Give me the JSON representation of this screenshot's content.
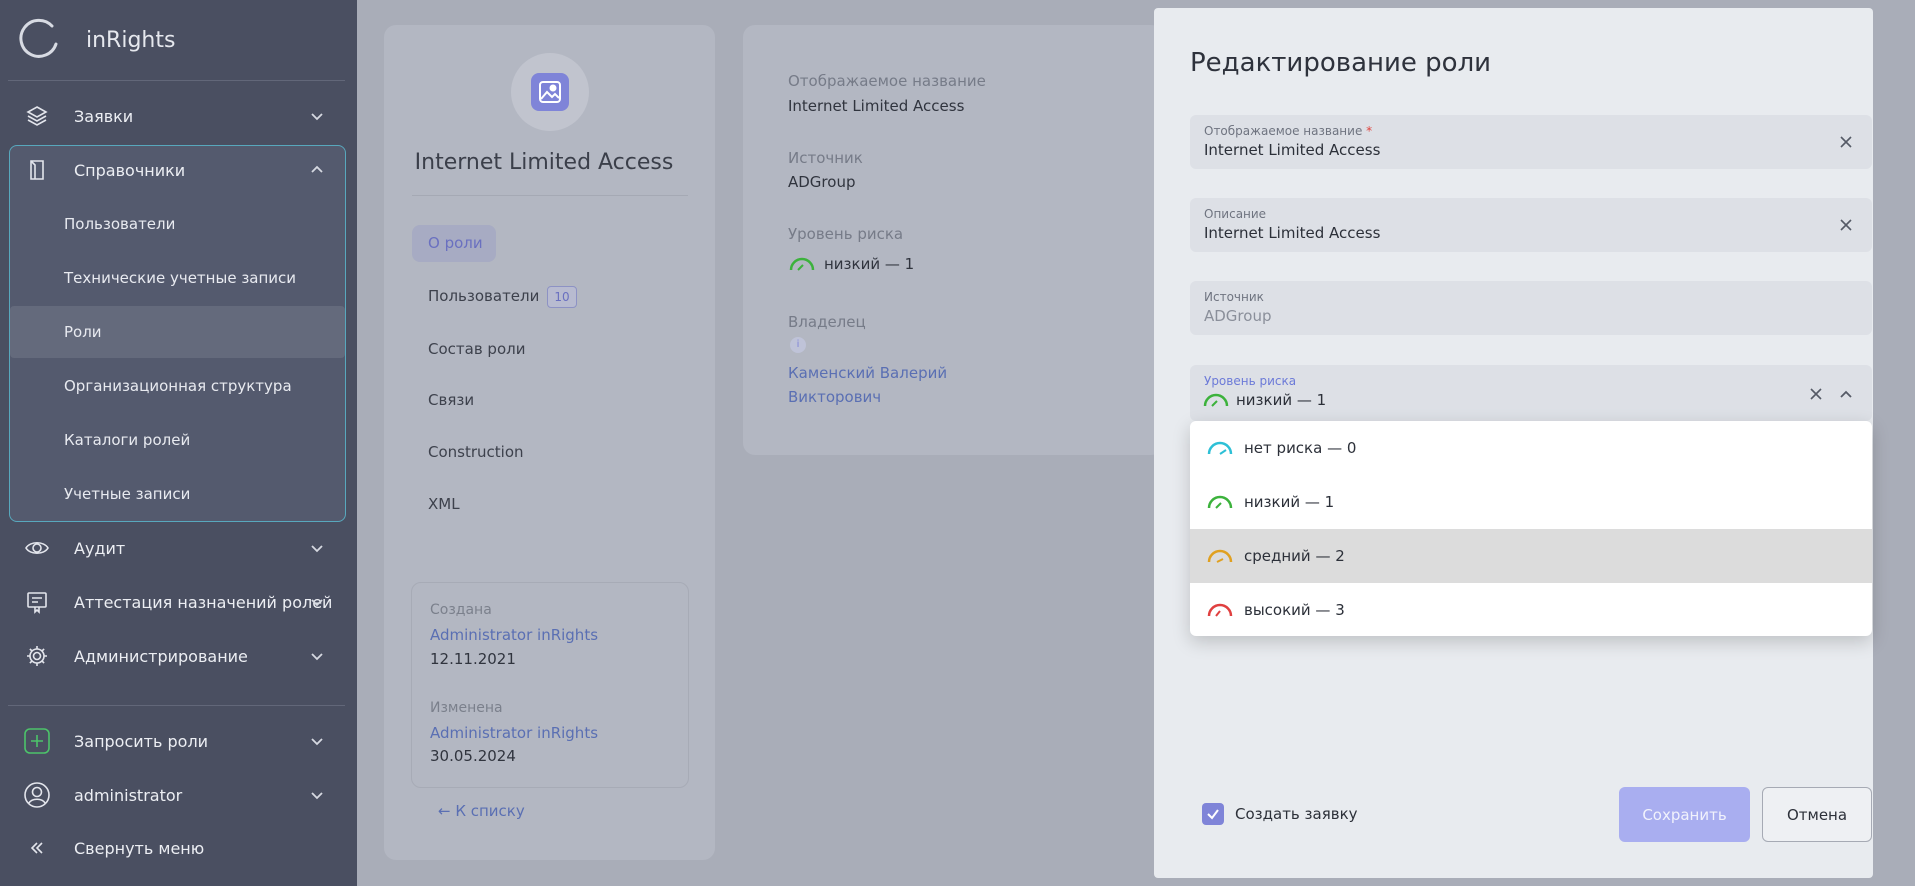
{
  "sidebar": {
    "brand": "inRights",
    "nav": {
      "requests": "Заявки",
      "directories": "Справочники",
      "audit": "Аудит",
      "attestation": "Аттестация назначений ролей",
      "administration": "Администрирование",
      "request_roles": "Запросить роли",
      "user": "administrator",
      "collapse": "Свернуть меню"
    },
    "sub_items": [
      "Пользователи",
      "Технические учетные записи",
      "Роли",
      "Организационная структура",
      "Каталоги ролей",
      "Учетные записи"
    ]
  },
  "role_card": {
    "title": "Internet Limited Access",
    "tabs": {
      "about": "О роли",
      "users": "Пользователи",
      "users_count": "10",
      "composition": "Состав роли",
      "links": "Связи",
      "construction": "Construction",
      "xml": "XML"
    },
    "created_label": "Создана",
    "created_by": "Administrator inRights",
    "created_date": "12.11.2021",
    "modified_label": "Изменена",
    "modified_by": "Administrator inRights",
    "modified_date": "30.05.2024",
    "back": "← К списку"
  },
  "info_panel": {
    "display_name_label": "Отображаемое название",
    "display_name": "Internet Limited Access",
    "source_label": "Источник",
    "source": "ADGroup",
    "risk_label": "Уровень риска",
    "risk": "низкий — 1",
    "owner_label": "Владелец",
    "owner_line1": "Каменский Валерий",
    "owner_line2": "Викторович"
  },
  "modal": {
    "title": "Редактирование роли",
    "fields": {
      "display_name_label": "Отображаемое название",
      "required_mark": "*",
      "display_name_value": "Internet Limited Access",
      "description_label": "Описание",
      "description_value": "Internet Limited Access",
      "source_label": "Источник",
      "source_value": "ADGroup",
      "risk_label": "Уровень риска",
      "risk_value": "низкий — 1"
    },
    "risk_options": [
      {
        "label": "нет риска — 0",
        "color": "#2ec0d6"
      },
      {
        "label": "низкий — 1",
        "color": "#3cb23c"
      },
      {
        "label": "средний — 2",
        "color": "#e0a020"
      },
      {
        "label": "высокий — 3",
        "color": "#e04040"
      }
    ],
    "create_request_label": "Создать заявку",
    "create_request_checked": true,
    "save": "Сохранить",
    "cancel": "Отмена"
  },
  "colors": {
    "sidebar_bg": "#4a4f61",
    "accent": "#7f84d8",
    "link": "#5a6fb3"
  }
}
